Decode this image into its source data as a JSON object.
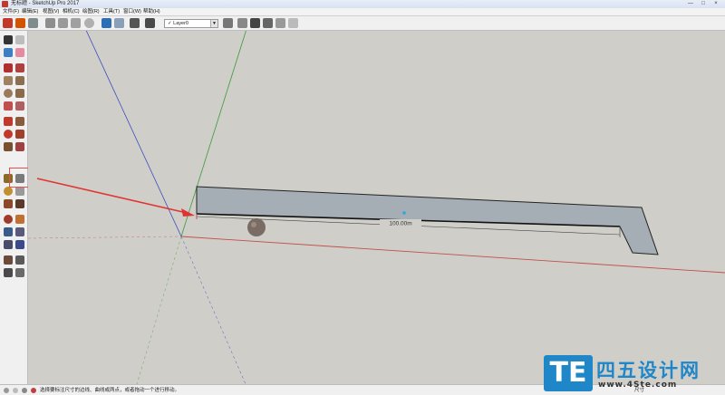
{
  "window": {
    "title": "无标题 - SketchUp Pro 2017",
    "controls": [
      "—",
      "□",
      "×"
    ]
  },
  "menubar": {
    "items": [
      "文件(F)",
      "编辑(E)",
      "视图(V)",
      "相机(C)",
      "绘图(R)",
      "工具(T)",
      "窗口(W)",
      "帮助(H)"
    ]
  },
  "toolbar": {
    "layer": {
      "check": "✓",
      "value": "Layer0"
    }
  },
  "viewport": {
    "dimension_label": "100.00m"
  },
  "statusbar": {
    "text": "选择要标注尺寸的边线、曲线或两点，或者拖动一个进行移动。",
    "vcb_label": "尺寸"
  },
  "watermark": {
    "logo": "TE",
    "name": "四五设计网",
    "url": "www.4Ste.com"
  },
  "colors": {
    "axis_red": "#c0504d",
    "axis_green": "#3c9a3c",
    "axis_blue": "#3c4fc0",
    "shape_fill": "#a5aeb5",
    "annotation_arrow": "#e03434",
    "brand_blue": "#1f86c8"
  },
  "icons": {
    "toolbar": [
      "components-icon",
      "warehouse-icon",
      "share-icon",
      "cut-icon",
      "copy-icon",
      "paste-icon",
      "erase-icon",
      "undo-icon",
      "redo-icon",
      "print-icon",
      "layers-icon",
      "model-info-icon",
      "house-icon",
      "iso-view-icon",
      "top-view-icon",
      "front-view-icon"
    ],
    "palette": [
      "select-icon",
      "make-component-icon",
      "paint-bucket-icon",
      "eraser-icon",
      "pencil-icon",
      "freehand-icon",
      "rectangle-icon",
      "rotated-rectangle-icon",
      "circle-icon",
      "polygon-icon",
      "arc-icon",
      "pie-icon",
      "move-icon",
      "push-pull-icon",
      "rotate-icon",
      "follow-me-icon",
      "scale-icon",
      "offset-icon",
      "tape-measure-icon",
      "dimension-icon",
      "protractor-icon",
      "text-icon",
      "axes-icon",
      "3d-text-icon",
      "orbit-icon",
      "pan-icon",
      "zoom-icon",
      "zoom-window-icon",
      "zoom-extents-icon",
      "position-camera-icon",
      "walk-icon",
      "look-around-icon",
      "section-plane-icon"
    ]
  }
}
